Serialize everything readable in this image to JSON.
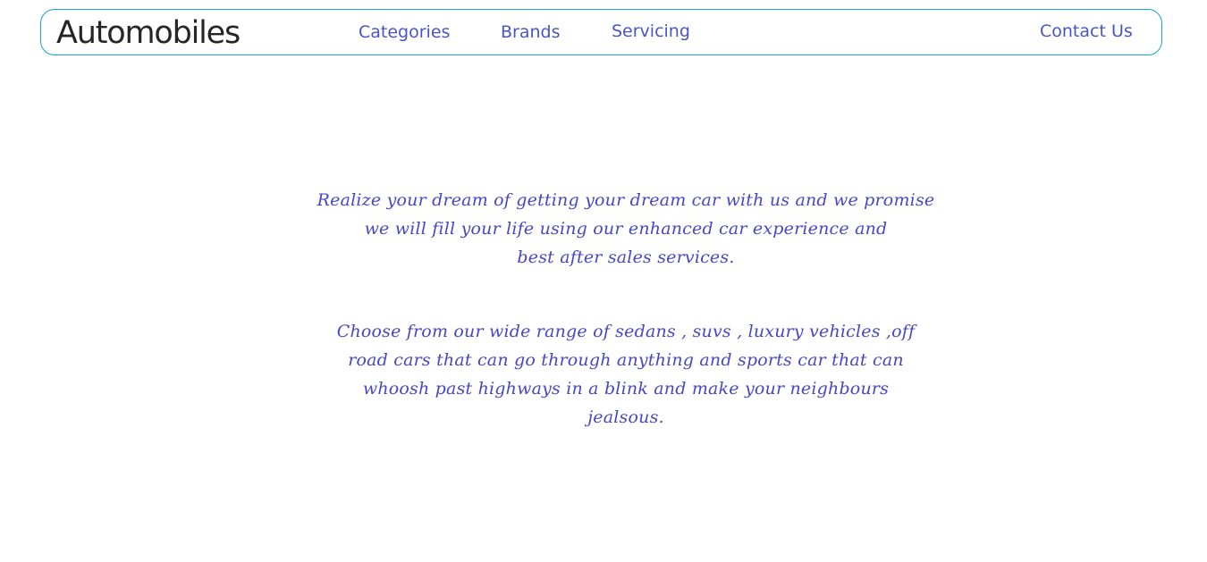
{
  "header": {
    "brand": "Automobiles",
    "nav": {
      "categories": "Categories",
      "brands": "Brands",
      "servicing": "Servicing",
      "contact": "Contact Us"
    }
  },
  "main": {
    "paragraph_1": [
      "Realize your dream of getting your dream car with us and we promise",
      "we will fill your life using our enhanced car experience and",
      "best after sales services."
    ],
    "paragraph_2": [
      "Choose from our wide range of sedans , suvs , luxury vehicles ,off",
      "road cars that can go through anything and sports car that can",
      "whoosh past highways in a blink and make your neighbours",
      "jealsous."
    ]
  }
}
